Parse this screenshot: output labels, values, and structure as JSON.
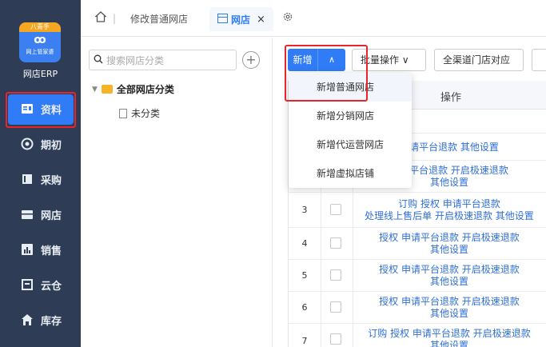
{
  "sidebar": {
    "logo": {
      "badge": "八青手",
      "mark": "ꝏ",
      "sub": "网上管家婆"
    },
    "app_name": "网店ERP",
    "items": [
      {
        "label": "资料",
        "icon": "id-card-icon",
        "active": true
      },
      {
        "label": "期初",
        "icon": "target-icon"
      },
      {
        "label": "采购",
        "icon": "book-icon"
      },
      {
        "label": "网店",
        "icon": "store-icon"
      },
      {
        "label": "销售",
        "icon": "bar-chart-icon"
      },
      {
        "label": "云仓",
        "icon": "warehouse-icon"
      },
      {
        "label": "库存",
        "icon": "house-icon"
      }
    ]
  },
  "topbar": {
    "home_sep": "|",
    "tab_edit": "修改普通网店",
    "tab_active": "网店",
    "close": "×"
  },
  "category": {
    "search_placeholder": "搜索网店分类",
    "add": "+",
    "root": "全部网店分类",
    "child": "未分类"
  },
  "toolbar": {
    "new_label": "新增",
    "new_arrow": "∧",
    "batch": "批量操作 ∨",
    "channel": "全渠道门店对应"
  },
  "dropdown": [
    "新增普通网店",
    "新增分销网店",
    "新增代运营网店",
    "新增虚拟店铺"
  ],
  "table": {
    "op_header": "操作",
    "rows": [
      {
        "num": "",
        "ops": [
          "",
          ""
        ]
      },
      {
        "num": "",
        "ops": [
          "申请平台退款  其他设置",
          ""
        ]
      },
      {
        "num": "",
        "ops": [
          "申请平台退款  开启极速退款",
          "其他设置"
        ]
      },
      {
        "num": "3",
        "ops": [
          "订购  授权  申请平台退款",
          "处理线上售后单  开启极速退款  其他设置"
        ]
      },
      {
        "num": "4",
        "ops": [
          "授权  申请平台退款  开启极速退款",
          "其他设置"
        ]
      },
      {
        "num": "5",
        "ops": [
          "授权  申请平台退款  开启极速退款",
          "其他设置"
        ]
      },
      {
        "num": "6",
        "ops": [
          "授权  申请平台退款  开启极速退款",
          "其他设置"
        ]
      },
      {
        "num": "7",
        "ops": [
          "订购  授权  申请平台退款  开启极速退款",
          "其他设置"
        ]
      }
    ]
  },
  "colors": {
    "sidebar": "#2e3c55",
    "accent": "#2f7cf6",
    "highlight": "#e8252c",
    "link": "#2f6fd6"
  }
}
